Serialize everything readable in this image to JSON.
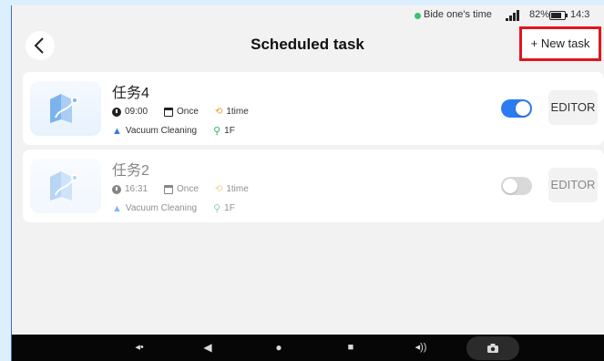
{
  "status_bar": {
    "activity_text": "Bide one's time",
    "battery_text": "82%",
    "time_text": "14:3"
  },
  "header": {
    "title": "Scheduled task",
    "new_task_label": "+ New task"
  },
  "tasks": [
    {
      "name": "任务4",
      "time": "09:00",
      "frequency": "Once",
      "repeat": "1time",
      "mode": "Vacuum Cleaning",
      "floor": "1F",
      "enabled": true,
      "editor_label": "EDITOR"
    },
    {
      "name": "任务2",
      "time": "16:31",
      "frequency": "Once",
      "repeat": "1time",
      "mode": "Vacuum Cleaning",
      "floor": "1F",
      "enabled": false,
      "editor_label": "EDITOR"
    }
  ],
  "colors": {
    "accent": "#2b7cf0",
    "highlight_border": "#e3141c",
    "status_dot": "#39c16c"
  },
  "icons": {
    "back": "chevron-left-icon",
    "time": "clock-icon",
    "frequency": "calendar-icon",
    "repeat": "repeat-icon",
    "mode": "vacuum-icon",
    "floor": "floor-icon"
  }
}
